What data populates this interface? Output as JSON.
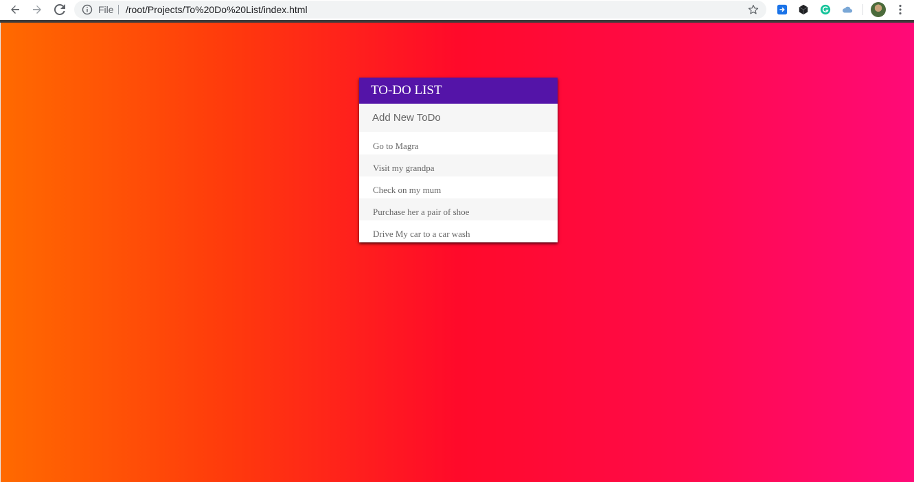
{
  "browser": {
    "file_label": "File",
    "url": "/root/Projects/To%20Do%20List/index.html",
    "icons": {
      "back": "back-arrow-icon",
      "forward": "forward-arrow-icon",
      "reload": "reload-icon",
      "info": "info-icon",
      "star": "star-icon",
      "menu": "more-vertical-icon"
    },
    "extensions": [
      "extension-share-icon",
      "extension-cube-icon",
      "extension-grammarly-icon",
      "extension-cloud-icon"
    ]
  },
  "todo": {
    "title": "TO-DO LIST",
    "input_placeholder": "Add New ToDo",
    "items": [
      "Go to Magra",
      "Visit my grandpa",
      "Check on my mum",
      "Purchase her a pair of shoe",
      "Drive My car to a car wash"
    ]
  },
  "colors": {
    "header_bg": "#5414a8",
    "gradient_start": "#ff6a00",
    "gradient_mid": "#ff0a2a",
    "gradient_end": "#ff0a78"
  }
}
